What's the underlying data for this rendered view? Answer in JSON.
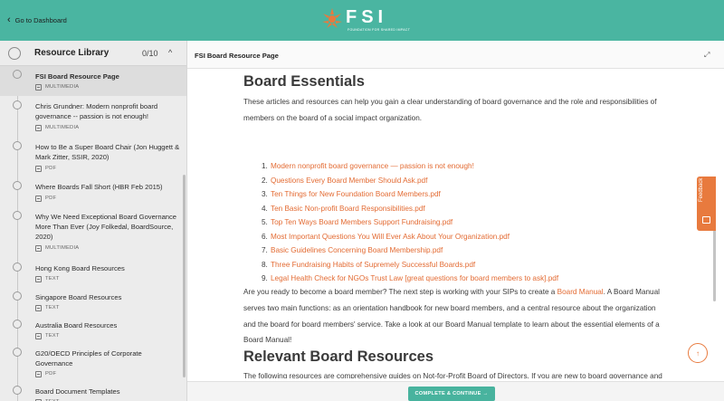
{
  "header": {
    "back_label": "Go to Dashboard",
    "logo_text": "FSI",
    "logo_tagline": "FOUNDATION FOR SHARED IMPACT",
    "brand_color": "#4ab5a1"
  },
  "sidebar": {
    "title": "Resource Library",
    "progress": "0/10",
    "items": [
      {
        "name": "FSI Board Resource Page",
        "type": "MULTIMEDIA"
      },
      {
        "name": "Chris Grundner: Modern nonprofit board governance -- passion is not enough!",
        "type": "MULTIMEDIA"
      },
      {
        "name": "How to Be a Super Board Chair (Jon Huggett & Mark Zitter, SSIR, 2020)",
        "type": "PDF"
      },
      {
        "name": "Where Boards Fall Short (HBR Feb 2015)",
        "type": "PDF"
      },
      {
        "name": "Why We Need Exceptional Board Governance More Than Ever (Joy Folkedal, BoardSource, 2020)",
        "type": "MULTIMEDIA"
      },
      {
        "name": "Hong Kong Board Resources",
        "type": "TEXT"
      },
      {
        "name": "Singapore Board Resources",
        "type": "TEXT"
      },
      {
        "name": "Australia Board Resources",
        "type": "TEXT"
      },
      {
        "name": "G20/OECD Principles of Corporate Governance",
        "type": "PDF"
      },
      {
        "name": "Board Document Templates",
        "type": "TEXT"
      }
    ]
  },
  "main": {
    "breadcrumb": "FSI Board Resource Page",
    "section1_title": "Board Essentials",
    "intro": "These articles and resources can help you gain a clear understanding of board governance and the role and responsibilities of members on the board of a social impact organization.",
    "links": [
      "Modern nonprofit board governance — passion is not enough!",
      "Questions Every Board Member Should Ask.pdf",
      "Ten Things for New Foundation Board Members.pdf",
      "Ten Basic Non-profit Board Responsibilities.pdf",
      "Top Ten Ways Board Members Support Fundraising.pdf",
      "Most Important Questions You Will Ever Ask About Your Organization.pdf",
      "Basic Guidelines Concerning Board Membership.pdf",
      "Three Fundraising Habits of Supremely Successful Boards.pdf",
      "Legal Health Check for NGOs Trust Law [great questions for board members to ask].pdf"
    ],
    "manual_before": "Are you ready to become a board member? The next step is working with your SIPs to create a ",
    "manual_link": "Board Manual",
    "manual_after": ". A Board Manual serves two main functions: as an orientation handbook for new board members, and a central resource about the organization and the board for board members' service. Take a look at our Board Manual template to learn about the essential elements of a Board Manual!",
    "section2_title": "Relevant Board Resources",
    "section2_text": "The following resources are comprehensive guides on Not-for-Profit Board of Directors. If you are new to board governance and wish to create your own board, these resources will help you gain an understanding of what having a board entails.",
    "feedback_label": "Feedback",
    "cta_label": "COMPLETE & CONTINUE →",
    "link_color": "#e36b33"
  }
}
